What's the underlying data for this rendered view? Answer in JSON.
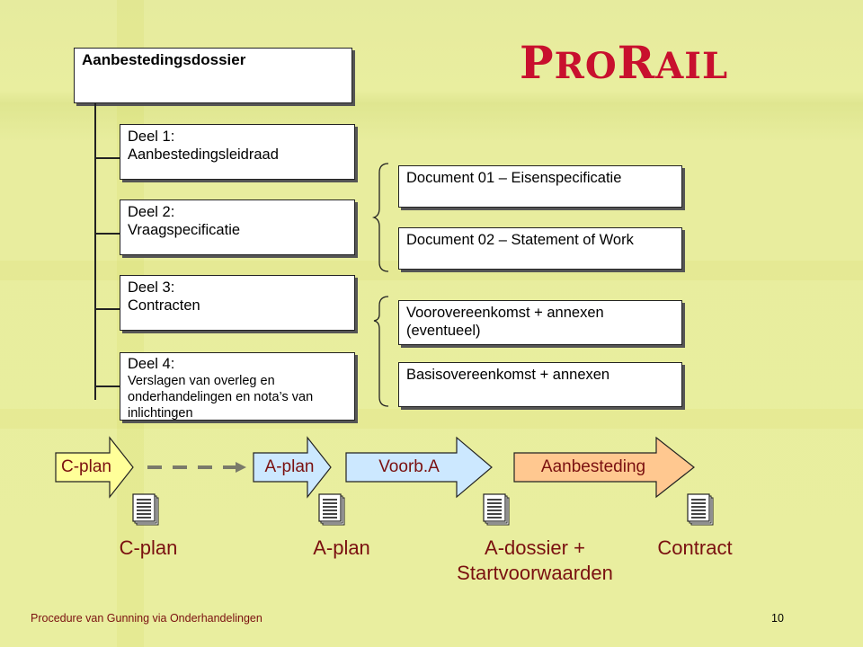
{
  "slide": {
    "title": "Aanbestedingsdossier",
    "logo": {
      "text_large_1": "P",
      "text_small_1": "RO",
      "text_large_2": "R",
      "text_small_2": "AIL",
      "color": "#c8102e"
    },
    "parts": [
      {
        "heading": "Deel 1:",
        "text": "Aanbestedingsleidraad"
      },
      {
        "heading": "Deel 2:",
        "text": "Vraagspecificatie"
      },
      {
        "heading": "Deel 3:",
        "text": "Contracten"
      },
      {
        "heading": "Deel 4:",
        "text": "Verslagen van overleg en onderhandelingen en nota’s van inlichtingen"
      }
    ],
    "documents": [
      {
        "text": "Document 01 – Eisenspecificatie"
      },
      {
        "text": "Document 02 – Statement of Work"
      },
      {
        "text": "Voorovereenkomst + annexen (eventueel)"
      },
      {
        "text": "Basisovereenkomst + annexen"
      }
    ],
    "process": [
      {
        "label": "C-plan",
        "color": "#ffff99"
      },
      {
        "label": "A-plan",
        "color": "#cce8ff"
      },
      {
        "label": "Voorb.A",
        "color": "#cce8ff"
      },
      {
        "label": "Aanbesteding",
        "color": "#ffc890"
      }
    ],
    "deliverables": [
      {
        "label": "C-plan"
      },
      {
        "label": "A-plan"
      },
      {
        "label": "A-dossier + Startvoorwaarden"
      },
      {
        "label": "Contract"
      }
    ],
    "footer": {
      "left": "Procedure van Gunning via Onderhandelingen",
      "page": "10"
    }
  }
}
